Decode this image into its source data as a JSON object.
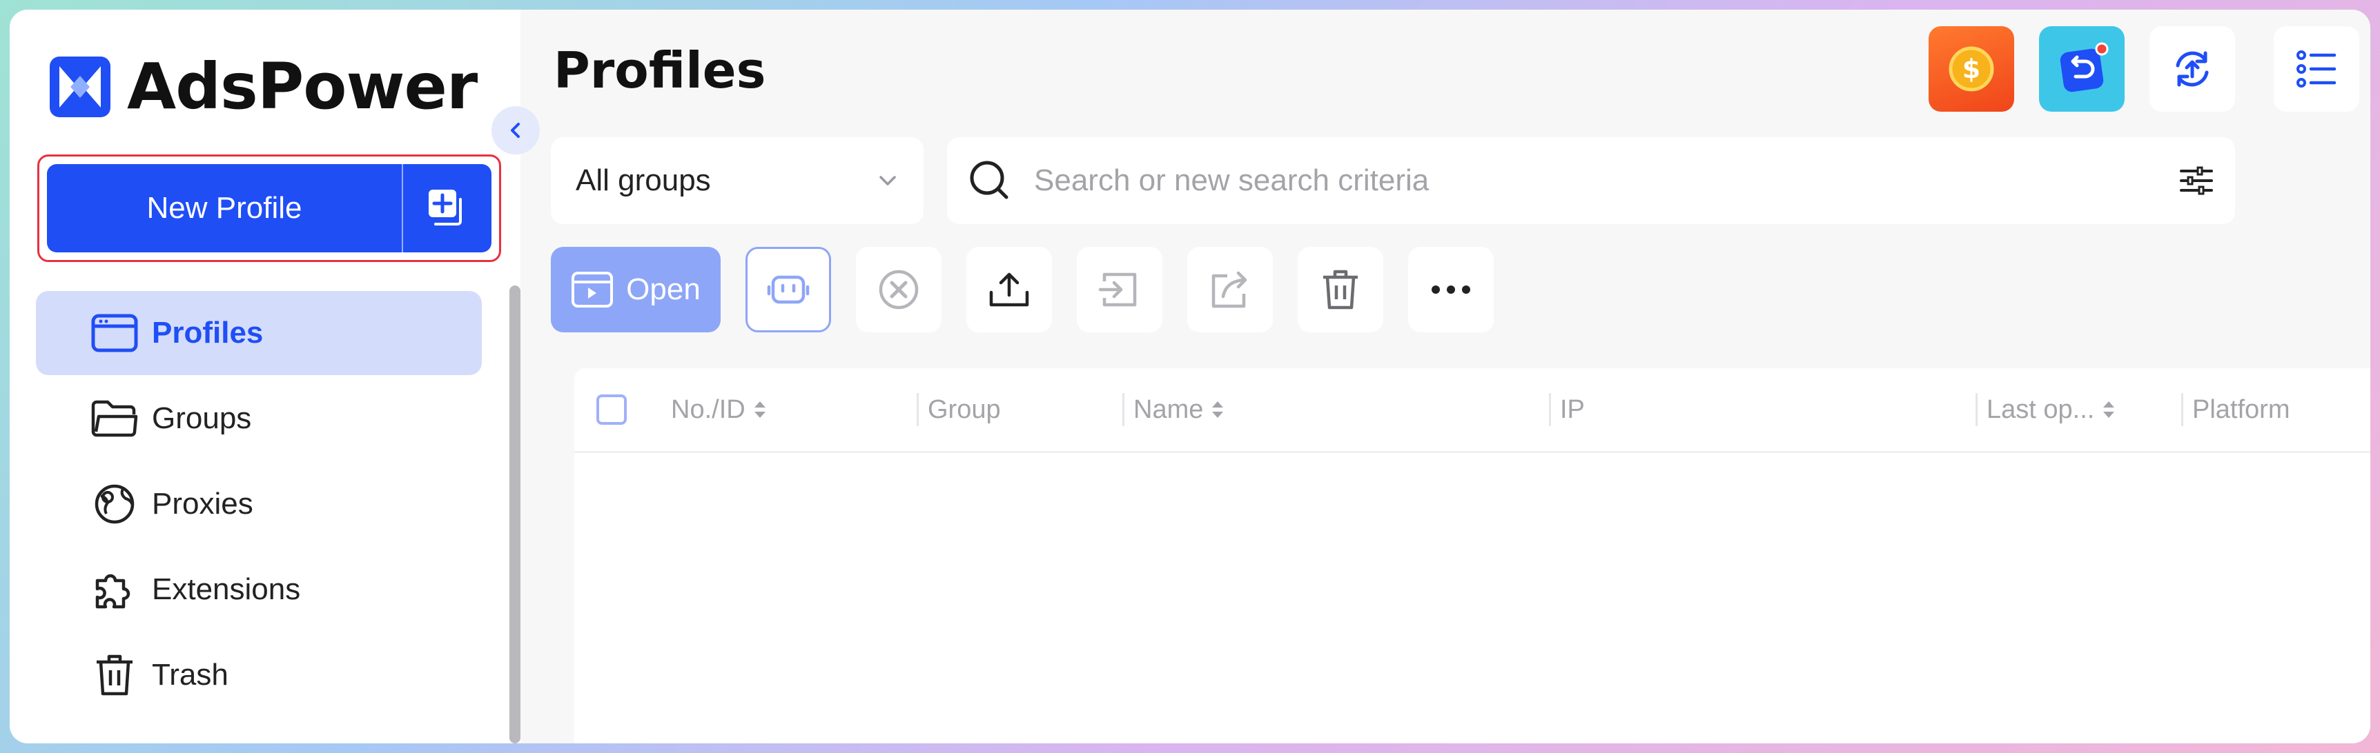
{
  "app": {
    "name": "AdsPower"
  },
  "sidebar": {
    "new_profile_label": "New Profile",
    "items": [
      {
        "label": "Profiles",
        "icon": "browser-window-icon",
        "active": true
      },
      {
        "label": "Groups",
        "icon": "folder-icon"
      },
      {
        "label": "Proxies",
        "icon": "globe-icon"
      },
      {
        "label": "Extensions",
        "icon": "puzzle-icon"
      },
      {
        "label": "Trash",
        "icon": "trash-icon"
      }
    ]
  },
  "header": {
    "title": "Profiles",
    "icons": [
      "coin-reward-icon",
      "update-notification-icon",
      "sync-icon",
      "list-settings-icon"
    ]
  },
  "filters": {
    "group_value": "All groups",
    "search_placeholder": "Search or new search criteria"
  },
  "toolbar": {
    "open_label": "Open",
    "actions": [
      "robot-icon",
      "close-circle-icon",
      "upload-icon",
      "import-icon",
      "share-icon",
      "trash-icon",
      "more-icon"
    ]
  },
  "table": {
    "columns": [
      "No./ID",
      "Group",
      "Name",
      "IP",
      "Last op...",
      "Platform"
    ]
  },
  "colors": {
    "accent": "#1f4ef5",
    "active_bg": "#d4dcfb",
    "highlight_border": "#e8313f"
  }
}
